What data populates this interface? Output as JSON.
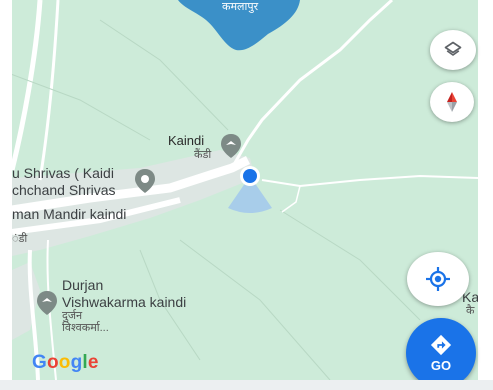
{
  "map": {
    "colors": {
      "land": "#cdebd9",
      "water": "#3b90c8",
      "road": "#ffffff",
      "settlement": "#dde6e3",
      "accent": "#1a73e8"
    },
    "top_label": "कमलापुर",
    "labels": {
      "kaindi": {
        "text": "Kaindi",
        "sub": "कैंडी"
      },
      "shrivas": {
        "line1": "u Shrivas ( Kaidi",
        "line2": "chchand Shrivas"
      },
      "mandir": {
        "text": "man Mandir kaindi"
      },
      "fragment": {
        "text": "ंडी"
      },
      "durjan": {
        "line1": "Durjan",
        "line2": "Vishwakarma kaindi",
        "sub1": "दुर्जन",
        "sub2": "विश्वकर्मा..."
      },
      "right_edge": {
        "line1": "Kai",
        "line2": "कै"
      }
    }
  },
  "controls": {
    "layers_icon": "layers-icon",
    "compass_icon": "compass-icon",
    "location_icon": "my-location-icon",
    "go_label": "GO",
    "directions_icon": "directions-icon"
  },
  "branding": {
    "logo_letters": [
      "G",
      "o",
      "o",
      "g",
      "l",
      "e"
    ],
    "logo_colors": [
      "#4285f4",
      "#ea4335",
      "#fbbc05",
      "#4285f4",
      "#34a853",
      "#ea4335"
    ]
  }
}
